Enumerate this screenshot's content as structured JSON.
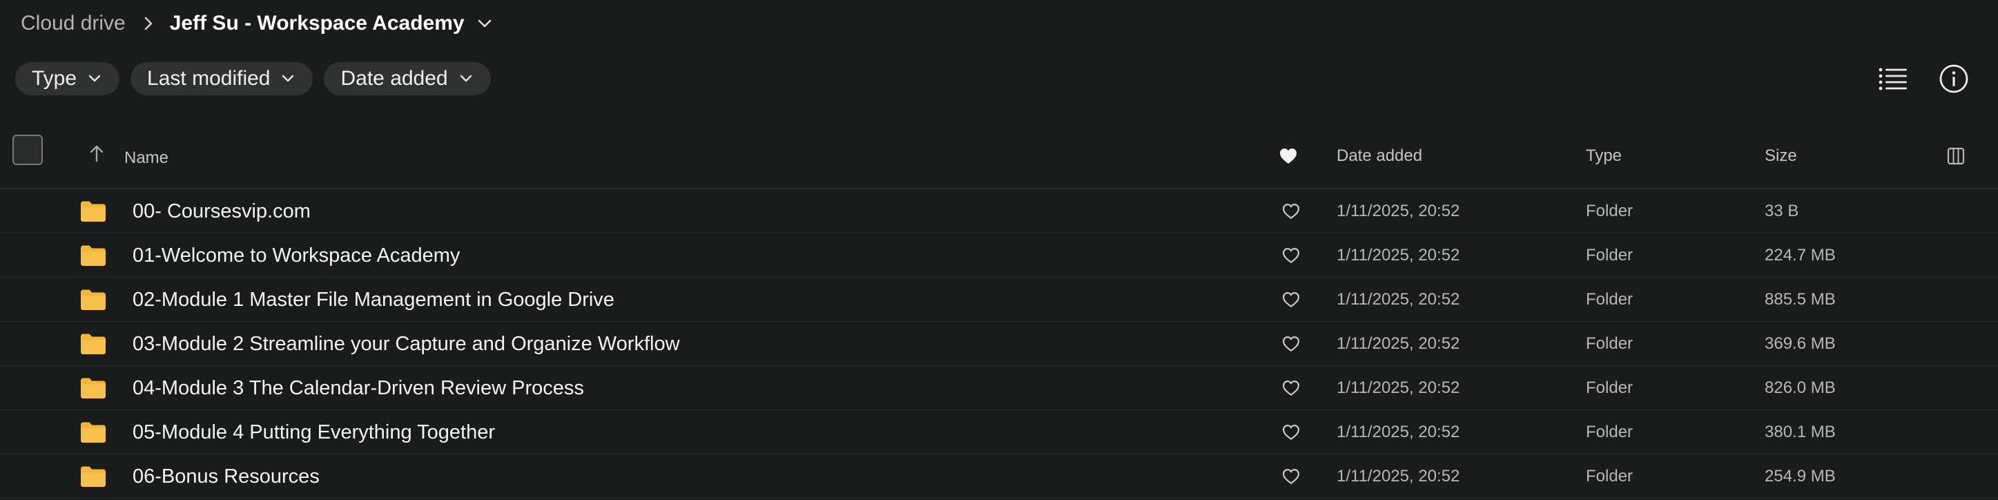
{
  "breadcrumb": {
    "root": "Cloud drive",
    "current": "Jeff Su - Workspace Academy"
  },
  "filters": [
    {
      "label": "Type"
    },
    {
      "label": "Last modified"
    },
    {
      "label": "Date added"
    }
  ],
  "toolbar": {
    "list_view_icon": "list-view-icon",
    "info_icon": "info-icon"
  },
  "table": {
    "columns": {
      "name": "Name",
      "date_added": "Date added",
      "type": "Type",
      "size": "Size"
    },
    "sort": "ascending",
    "rows": [
      {
        "name": "00- Coursesvip.com",
        "date_added": "1/11/2025, 20:52",
        "type": "Folder",
        "size": "33 B"
      },
      {
        "name": "01-Welcome to Workspace Academy",
        "date_added": "1/11/2025, 20:52",
        "type": "Folder",
        "size": "224.7 MB"
      },
      {
        "name": "02-Module 1 Master File Management in Google Drive",
        "date_added": "1/11/2025, 20:52",
        "type": "Folder",
        "size": "885.5 MB"
      },
      {
        "name": "03-Module 2 Streamline your Capture and Organize Workflow",
        "date_added": "1/11/2025, 20:52",
        "type": "Folder",
        "size": "369.6 MB"
      },
      {
        "name": "04-Module 3 The Calendar-Driven Review Process",
        "date_added": "1/11/2025, 20:52",
        "type": "Folder",
        "size": "826.0 MB"
      },
      {
        "name": "05-Module 4 Putting Everything Together",
        "date_added": "1/11/2025, 20:52",
        "type": "Folder",
        "size": "380.1 MB"
      },
      {
        "name": "06-Bonus Resources",
        "date_added": "1/11/2025, 20:52",
        "type": "Folder",
        "size": "254.9 MB"
      }
    ]
  },
  "colors": {
    "background": "#1a1b1b",
    "chip": "#303131",
    "folder": "#f2b53a"
  }
}
